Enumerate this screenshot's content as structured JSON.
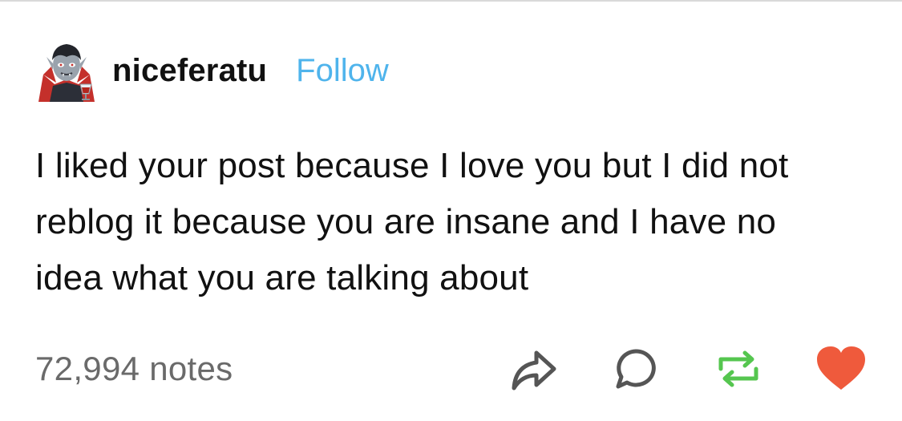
{
  "post": {
    "username": "niceferatu",
    "follow_label": "Follow",
    "avatar_icon": "vampire-avatar",
    "body_lines": [
      "I liked your post because I love you but I did not",
      "reblog it because you are insane and I have no",
      "idea what you are talking about"
    ],
    "notes_label": "72,994 notes"
  },
  "actions": {
    "share_icon": "share-icon",
    "reply_icon": "reply-icon",
    "reblog_icon": "reblog-icon",
    "like_icon": "heart-icon"
  },
  "colors": {
    "follow": "#4fb4ec",
    "reblog": "#55c64f",
    "like": "#ef5a3c",
    "notes": "#6a6a6a",
    "icon": "#555555"
  }
}
